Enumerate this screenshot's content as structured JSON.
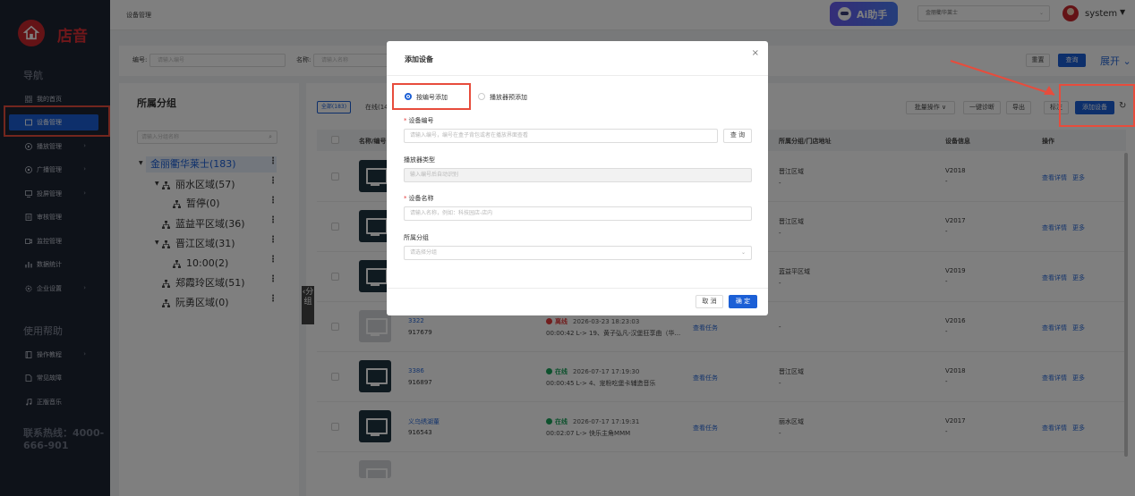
{
  "brand": {
    "name": "店音",
    "color": "#c9272d"
  },
  "sidebar": {
    "nav_title": "导航",
    "items": [
      {
        "label": "我的首页",
        "icon": "grid-icon",
        "arrow": ""
      },
      {
        "label": "设备管理",
        "icon": "device-icon",
        "arrow": ""
      },
      {
        "label": "播放管理",
        "icon": "play-icon",
        "arrow": "›"
      },
      {
        "label": "广播管理",
        "icon": "broadcast-icon",
        "arrow": "›"
      },
      {
        "label": "投屏管理",
        "icon": "screen-icon",
        "arrow": "›"
      },
      {
        "label": "审核管理",
        "icon": "audit-icon",
        "arrow": ""
      },
      {
        "label": "监控管理",
        "icon": "monitor-icon",
        "arrow": ""
      },
      {
        "label": "数据统计",
        "icon": "chart-icon",
        "arrow": ""
      },
      {
        "label": "企业设置",
        "icon": "settings-icon",
        "arrow": "›"
      }
    ],
    "help_title": "使用帮助",
    "help_items": [
      {
        "label": "操作教程",
        "icon": "book-icon",
        "arrow": "›"
      },
      {
        "label": "常见故障",
        "icon": "doc-icon",
        "arrow": ""
      },
      {
        "label": "正版音乐",
        "icon": "music-icon",
        "arrow": ""
      }
    ],
    "hotline": "联系热线：4000-666-901"
  },
  "topbar": {
    "breadcrumb": "设备管理",
    "ai_label": "Ai助手",
    "store": "金丽衢华莱士",
    "user": "system",
    "caret": "▼"
  },
  "filter": {
    "code_label": "编号:",
    "code_placeholder": "请输入编号",
    "name_label": "名称:",
    "name_placeholder": "请输入名称",
    "reset": "重置",
    "query": "查询",
    "expand": "展开"
  },
  "tree": {
    "title": "所属分组",
    "search_placeholder": "请输入分组名称",
    "nodes": [
      {
        "label": "金丽衢华莱士(183)"
      },
      {
        "label": "丽水区域(57)"
      },
      {
        "label": "暂停(0)"
      },
      {
        "label": "蓝益平区域(36)"
      },
      {
        "label": "晋江区域(31)"
      },
      {
        "label": "10:00(2)"
      },
      {
        "label": "郑霞玲区域(51)"
      },
      {
        "label": "阮勇区域(0)"
      }
    ],
    "collapse_label": "‹分组"
  },
  "main": {
    "tab_all": "全部(183)",
    "tab_online": "在线(14",
    "toolbar": {
      "batch": "批量操作 ∨",
      "diagnose": "一键诊断",
      "export": "导出",
      "tag": "标注",
      "add": "添加设备"
    },
    "headers": {
      "name": "名称/编号",
      "group": "所属分组/门店地址",
      "info": "设备信息",
      "op": "操作"
    },
    "rows": [
      {
        "name": "",
        "code": "",
        "status": "",
        "time": "",
        "play": "",
        "task": "",
        "group": "晋江区域",
        "info": "V2018",
        "online": true
      },
      {
        "name": "",
        "code": "",
        "status": "",
        "time": "",
        "play": "",
        "task": "",
        "group": "晋江区域",
        "info": "V2017",
        "online": true
      },
      {
        "name": "",
        "code": "",
        "status": "",
        "time": "",
        "play": "",
        "task": "",
        "group": "蓝益平区域",
        "info": "V2019",
        "online": true
      },
      {
        "name": "3322",
        "code": "917679",
        "status": "离线",
        "time": "2026-03-23 18:23:03",
        "play": "00:00:42 L-> 19、黄子弘凡-汉堡狂享曲（华...",
        "task": "查看任务",
        "group": "",
        "info": "V2016",
        "online": false
      },
      {
        "name": "3386",
        "code": "916897",
        "status": "在线",
        "time": "2026-07-17 17:19:30",
        "play": "00:00:45 L-> 4、宠粉吃堡卡辅造音乐",
        "task": "查看任务",
        "group": "晋江区域",
        "info": "V2018",
        "online": true
      },
      {
        "name": "义乌绣湖董",
        "code": "916543",
        "status": "在线",
        "time": "2026-07-17 17:19:31",
        "play": "00:02:07 L-> 快乐主角MMM",
        "task": "查看任务",
        "group": "丽水区域",
        "info": "V2017",
        "online": true
      }
    ],
    "dash": "-",
    "op_detail": "查看详情",
    "op_more": "更多"
  },
  "modal": {
    "title": "添加设备",
    "close": "×",
    "radio_code": "按编号添加",
    "radio_player": "播放器预添加",
    "device_code_label": "设备编号",
    "device_code_placeholder": "请输入编号，编号在盒子背包或者在播放界面查看",
    "query_btn": "查 询",
    "player_type_label": "播放器类型",
    "player_type_placeholder": "输入编号后自动识别",
    "device_name_label": "设备名称",
    "device_name_placeholder": "请输入名称，例如：科技园店-店内",
    "group_label": "所属分组",
    "group_placeholder": "请选择分组",
    "cancel": "取 消",
    "ok": "确 定"
  },
  "colors": {
    "primary": "#1b5fd6",
    "online": "#1aa35b",
    "offline": "#e23b3b",
    "highlight": "#e74c3c"
  }
}
